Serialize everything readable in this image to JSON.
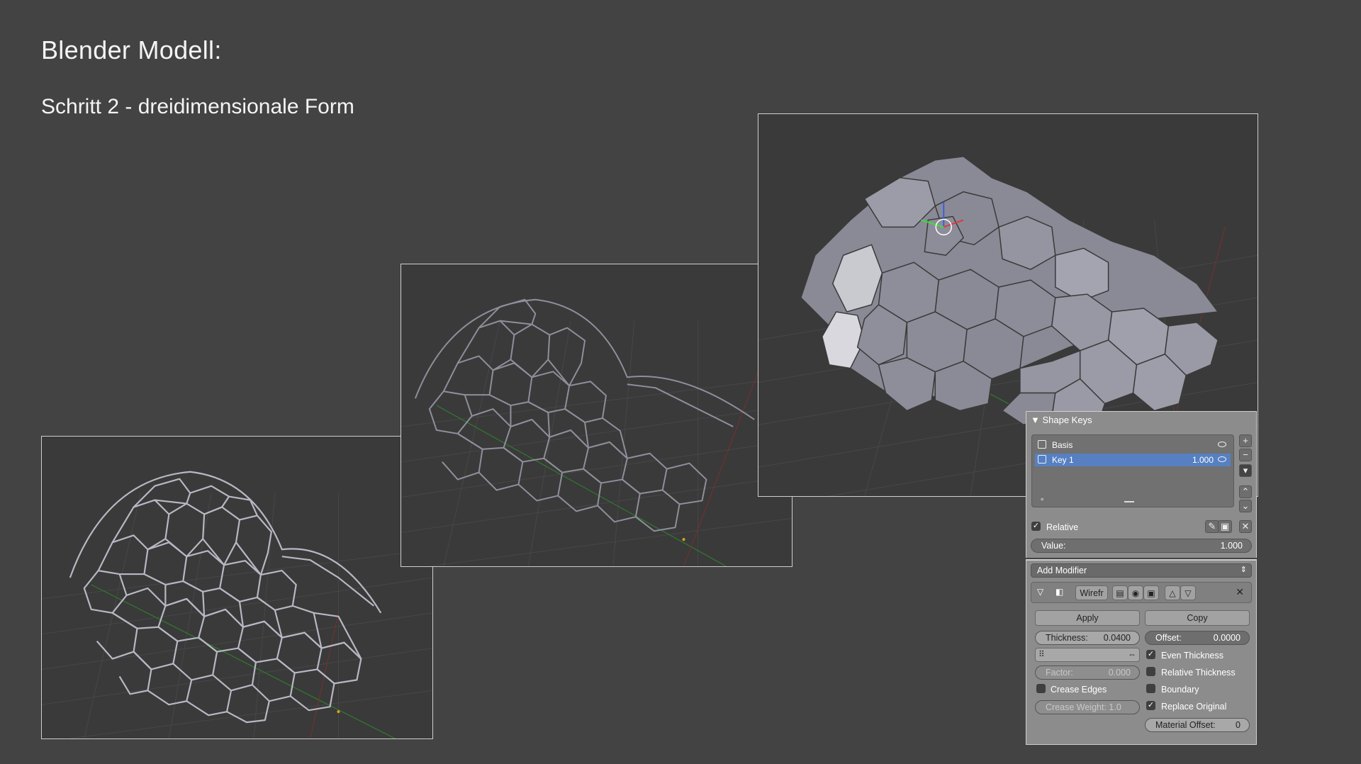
{
  "title": "Blender Modell:",
  "subtitle": "Schritt 2 - dreidimensionale Form",
  "shape_keys": {
    "header": "Shape Keys",
    "items": [
      {
        "label": "Basis",
        "value": ""
      },
      {
        "label": "Key 1",
        "value": "1.000"
      }
    ],
    "relative_label": "Relative",
    "value_label": "Value:",
    "value": "1.000"
  },
  "modifier": {
    "add_modifier_label": "Add Modifier",
    "name": "Wirefr",
    "apply_label": "Apply",
    "copy_label": "Copy",
    "thickness_label": "Thickness:",
    "thickness_value": "0.0400",
    "offset_label": "Offset:",
    "offset_value": "0.0000",
    "factor_label": "Factor:",
    "factor_value": "0.000",
    "crease_edges_label": "Crease Edges",
    "crease_weight_label": "Crease Weight: 1.0",
    "even_thickness_label": "Even Thickness",
    "relative_thickness_label": "Relative Thickness",
    "boundary_label": "Boundary",
    "replace_original_label": "Replace Original",
    "material_offset_label": "Material Offset:",
    "material_offset_value": "0",
    "checks": {
      "even_thickness": true,
      "relative_thickness": false,
      "boundary": false,
      "replace_original": true,
      "crease_edges": false,
      "relative": true
    }
  },
  "colors": {
    "background": "#434343",
    "viewport": "#3a3a3a",
    "panel": "#8c8c8c",
    "selection": "#5680c2"
  }
}
